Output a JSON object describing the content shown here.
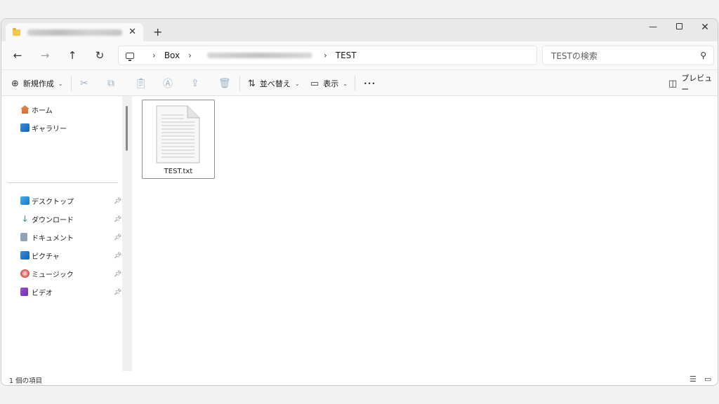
{
  "tab": {
    "close": "✕"
  },
  "window_controls": {
    "minimize": "—",
    "close": "✕"
  },
  "nav": {
    "back": "←",
    "forward": "→",
    "up": "↑",
    "refresh": "↻"
  },
  "address": {
    "crumb1": "Box",
    "crumb_last": "TEST",
    "separator": "›"
  },
  "search": {
    "placeholder": "TESTの検索",
    "icon": "search-icon"
  },
  "toolbar": {
    "new_label": "新規作成",
    "sort_label": "並べ替え",
    "view_label": "表示",
    "more_label": "•••",
    "preview_label": "プレビュー"
  },
  "sidebar": {
    "top_items": [
      {
        "label": "ホーム",
        "icon": "home-icon"
      },
      {
        "label": "ギャラリー",
        "icon": "gallery-icon"
      }
    ],
    "pinned_items": [
      {
        "label": "デスクトップ",
        "icon": "desktop-icon"
      },
      {
        "label": "ダウンロード",
        "icon": "download-icon"
      },
      {
        "label": "ドキュメント",
        "icon": "documents-icon"
      },
      {
        "label": "ピクチャ",
        "icon": "pictures-icon"
      },
      {
        "label": "ミュージック",
        "icon": "music-icon"
      },
      {
        "label": "ビデオ",
        "icon": "videos-icon"
      }
    ]
  },
  "files": [
    {
      "name": "TEST.txt",
      "icon": "text-file-icon"
    }
  ],
  "status": {
    "item_count": "1 個の項目"
  },
  "colors": {
    "accent": "#0067c0",
    "folder": "#f2c84b",
    "window_bg": "#ffffff",
    "chrome_bg": "#f9f9f9"
  }
}
